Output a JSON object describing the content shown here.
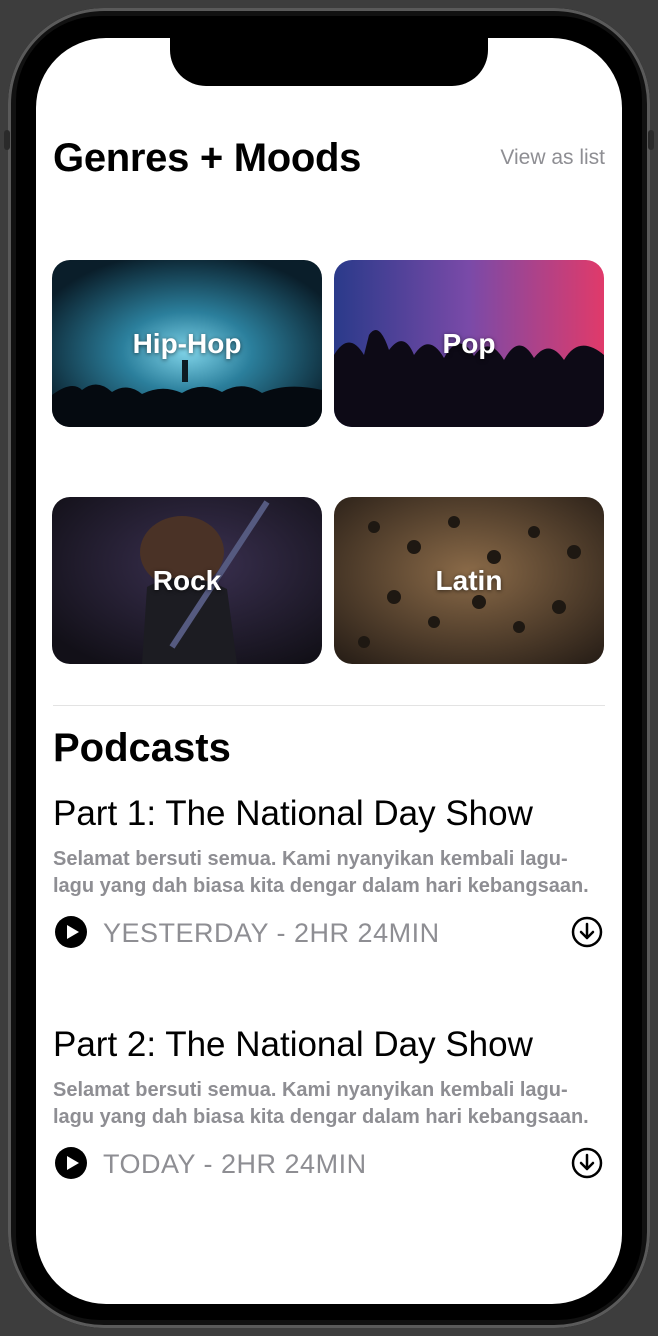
{
  "genres_section": {
    "title": "Genres + Moods",
    "view_as_list": "View as list",
    "tiles": [
      {
        "label": "Hip-Hop"
      },
      {
        "label": "Pop"
      },
      {
        "label": "Rock"
      },
      {
        "label": "Latin"
      }
    ]
  },
  "podcasts_section": {
    "title": "Podcasts",
    "episodes": [
      {
        "title": "Part 1: The National Day Show",
        "description": "Selamat bersuti semua. Kami nyanyikan kembali lagu-lagu yang dah biasa kita dengar dalam hari kebangsaan.",
        "meta": "YESTERDAY - 2HR 24MIN"
      },
      {
        "title": "Part 2: The National Day Show",
        "description": "Selamat bersuti semua. Kami nyanyikan kembali lagu-lagu yang dah biasa kita dengar dalam hari kebangsaan.",
        "meta": "TODAY - 2HR 24MIN"
      }
    ]
  },
  "icons": {
    "play": "play-circle-icon",
    "download": "download-circle-icon"
  },
  "colors": {
    "secondary_text": "#8e8e93",
    "primary_text": "#000000",
    "background": "#ffffff"
  }
}
